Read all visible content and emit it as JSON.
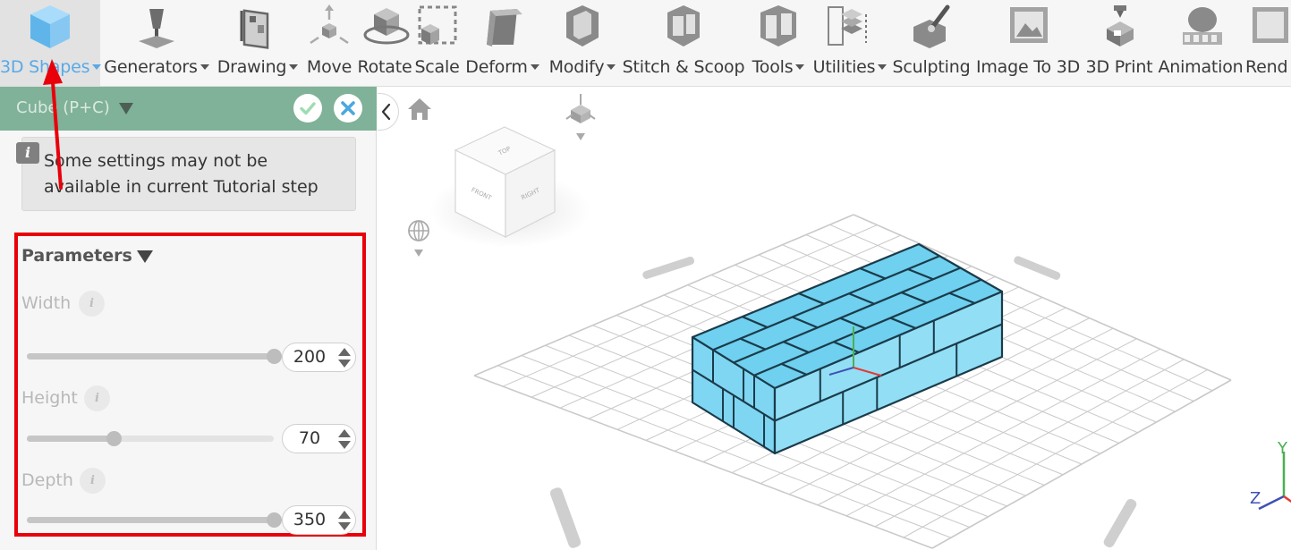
{
  "toolbar": {
    "items": [
      {
        "label": "3D Shapes",
        "icon": "cube-icon",
        "dropdown": true,
        "active": true
      },
      {
        "label": "Generators",
        "icon": "generators-icon",
        "dropdown": true
      },
      {
        "label": "Drawing",
        "icon": "drawing-icon",
        "dropdown": true
      },
      {
        "label": "Move",
        "icon": "move-icon",
        "dropdown": false
      },
      {
        "label": "Rotate",
        "icon": "rotate-icon",
        "dropdown": false
      },
      {
        "label": "Scale",
        "icon": "scale-icon",
        "dropdown": false
      },
      {
        "label": "Deform",
        "icon": "deform-icon",
        "dropdown": true
      },
      {
        "label": "Modify",
        "icon": "modify-icon",
        "dropdown": true
      },
      {
        "label": "Stitch & Scoop",
        "icon": "stitch-scoop-icon",
        "dropdown": false
      },
      {
        "label": "Tools",
        "icon": "tools-icon",
        "dropdown": true
      },
      {
        "label": "Utilities",
        "icon": "utilities-icon",
        "dropdown": true
      },
      {
        "label": "Sculpting",
        "icon": "sculpting-icon",
        "dropdown": false
      },
      {
        "label": "Image To 3D",
        "icon": "image-to-3d-icon",
        "dropdown": false
      },
      {
        "label": "3D Print",
        "icon": "3d-print-icon",
        "dropdown": false
      },
      {
        "label": "Animation",
        "icon": "animation-icon",
        "dropdown": false
      },
      {
        "label": "Rend",
        "icon": "render-icon",
        "dropdown": false
      }
    ]
  },
  "panel": {
    "title": "Cube (P+C)",
    "confirm_icon": "check-icon",
    "cancel_icon": "close-icon",
    "notice": "Some settings may not be available in current Tutorial step",
    "notice_icon": "info-icon",
    "parameters_title": "Parameters",
    "params": [
      {
        "label": "Width",
        "value": "200",
        "slider_fraction": 1.0
      },
      {
        "label": "Height",
        "value": "70",
        "slider_fraction": 0.35
      },
      {
        "label": "Depth",
        "value": "350",
        "slider_fraction": 1.0
      }
    ]
  },
  "viewport": {
    "view_cube": {
      "top": "TOP",
      "front": "FRONT",
      "right": "RIGHT"
    },
    "axis_labels": {
      "y": "Y",
      "z": "Z"
    },
    "colors": {
      "cube_fill": "#6fd0ef",
      "cube_edge": "#1b3b4a",
      "grid": "#c9c9c9"
    }
  },
  "annotations": {
    "highlight_color": "#e8000b"
  }
}
